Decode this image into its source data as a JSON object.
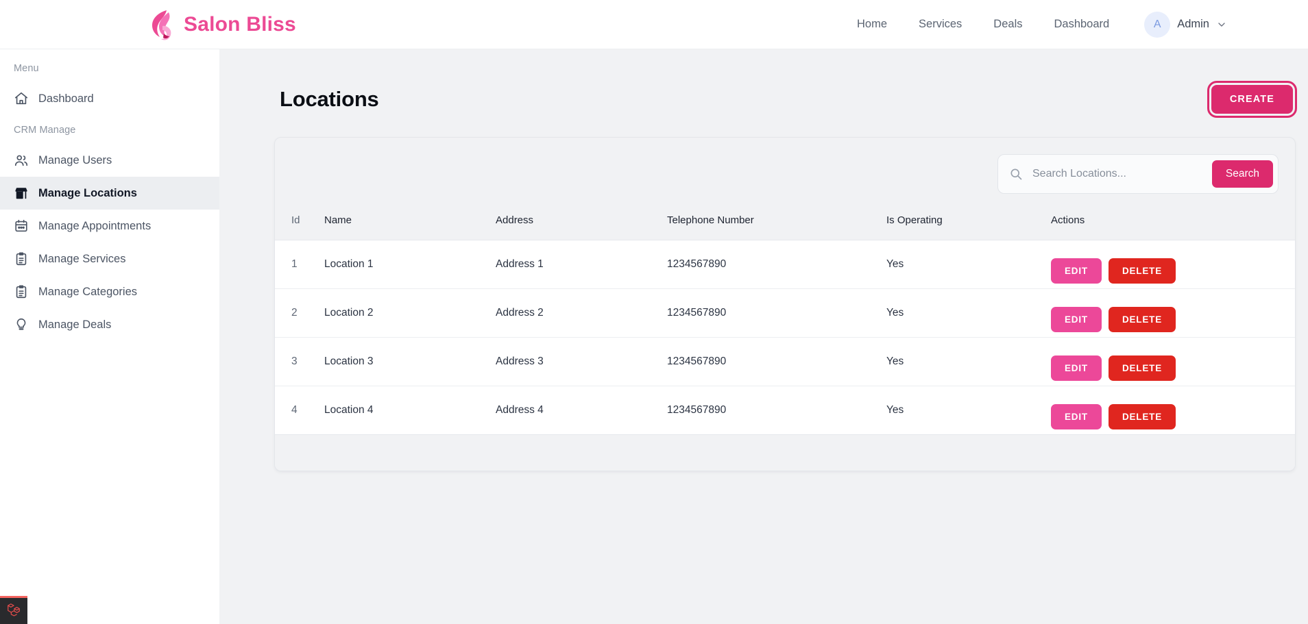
{
  "brand": {
    "name": "Salon Bliss",
    "accent": "#ec4a94"
  },
  "topnav": {
    "links": [
      {
        "label": "Home"
      },
      {
        "label": "Services"
      },
      {
        "label": "Deals"
      },
      {
        "label": "Dashboard"
      }
    ],
    "user": {
      "initial": "A",
      "name": "Admin"
    }
  },
  "sidebar": {
    "section_menu": "Menu",
    "section_crm": "CRM Manage",
    "menu_items": [
      {
        "label": "Dashboard",
        "icon": "home-icon",
        "active": false
      }
    ],
    "crm_items": [
      {
        "label": "Manage Users",
        "icon": "users-icon",
        "active": false
      },
      {
        "label": "Manage Locations",
        "icon": "store-icon",
        "active": true
      },
      {
        "label": "Manage Appointments",
        "icon": "calendar-icon",
        "active": false
      },
      {
        "label": "Manage Services",
        "icon": "clipboard-list-icon",
        "active": false
      },
      {
        "label": "Manage Categories",
        "icon": "clipboard-list-icon",
        "active": false
      },
      {
        "label": "Manage Deals",
        "icon": "lightbulb-icon",
        "active": false
      }
    ]
  },
  "page": {
    "title": "Locations",
    "create_label": "CREATE",
    "create_color": "#dc2a6d"
  },
  "search": {
    "placeholder": "Search Locations...",
    "value": "",
    "button_label": "Search",
    "button_color": "#dc2a6d"
  },
  "table": {
    "headers": [
      "Id",
      "Name",
      "Address",
      "Telephone Number",
      "Is Operating",
      "Actions"
    ],
    "rows": [
      {
        "id": "1",
        "name": "Location 1",
        "address": "Address 1",
        "phone": "1234567890",
        "operating": "Yes",
        "edit": "EDIT",
        "delete": "DELETE"
      },
      {
        "id": "2",
        "name": "Location 2",
        "address": "Address 2",
        "phone": "1234567890",
        "operating": "Yes",
        "edit": "EDIT",
        "delete": "DELETE"
      },
      {
        "id": "3",
        "name": "Location 3",
        "address": "Address 3",
        "phone": "1234567890",
        "operating": "Yes",
        "edit": "EDIT",
        "delete": "DELETE"
      },
      {
        "id": "4",
        "name": "Location 4",
        "address": "Address 4",
        "phone": "1234567890",
        "operating": "Yes",
        "edit": "EDIT",
        "delete": "DELETE"
      }
    ],
    "edit_color": "#ec4899",
    "delete_color": "#e0261f"
  },
  "debugbar": {
    "icon": "laravel-icon"
  }
}
